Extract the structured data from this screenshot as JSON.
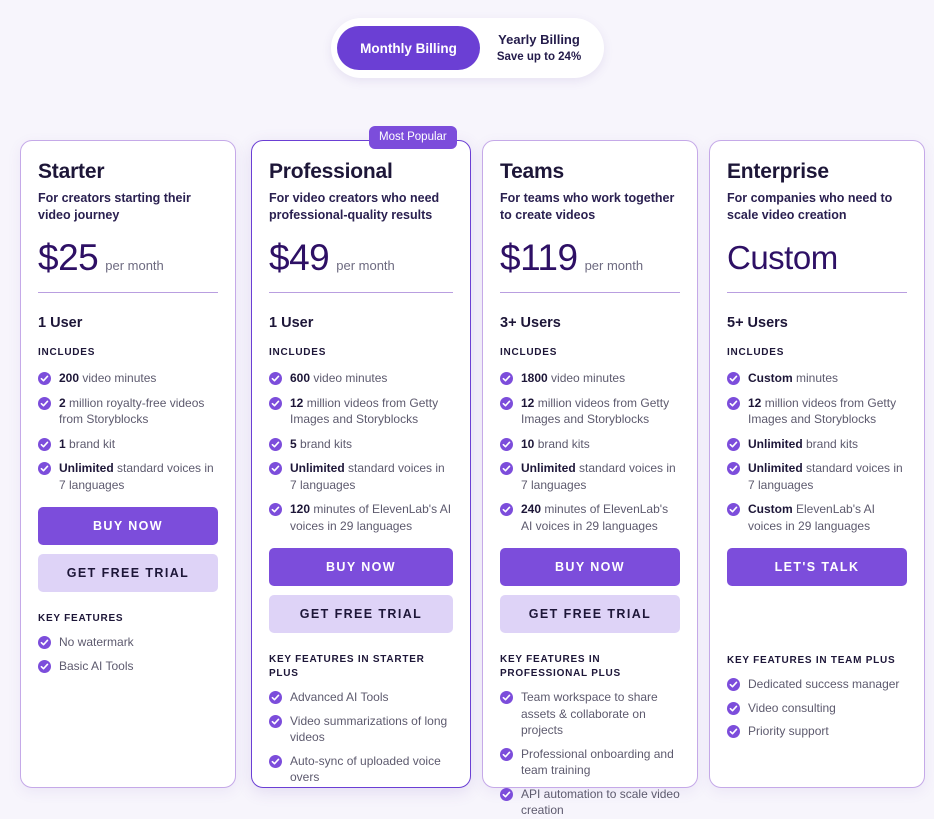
{
  "billing": {
    "monthly_label": "Monthly Billing",
    "yearly_label": "Yearly Billing",
    "yearly_sub": "Save up to 24%",
    "selected": "monthly",
    "accent_color": "#6b3fd4"
  },
  "badge": {
    "most_popular": "Most Popular"
  },
  "labels": {
    "includes": "INCLUDES",
    "buy_now": "BUY NOW",
    "get_free_trial": "GET FREE TRIAL",
    "lets_talk": "LET'S TALK"
  },
  "plans": [
    {
      "name": "Starter",
      "description": "For creators starting their video journey",
      "price": "$25",
      "period": "per month",
      "seats": "1 User",
      "includes_label": "INCLUDES",
      "includes": [
        {
          "strong": "200",
          "rest": " video minutes"
        },
        {
          "strong": "2",
          "rest": " million royalty-free videos from Storyblocks"
        },
        {
          "strong": "1",
          "rest": " brand kit"
        },
        {
          "strong": "Unlimited",
          "rest": " standard voices in 7 languages"
        }
      ],
      "primary_cta": "BUY NOW",
      "secondary_cta": "GET FREE TRIAL",
      "key_features_label": "KEY FEATURES",
      "key_features": [
        "No watermark",
        "Basic AI Tools"
      ]
    },
    {
      "name": "Professional",
      "description": "For video creators who need professional-quality results",
      "price": "$49",
      "period": "per month",
      "seats": "1 User",
      "includes_label": "INCLUDES",
      "includes": [
        {
          "strong": "600",
          "rest": " video minutes"
        },
        {
          "strong": "12",
          "rest": " million videos from Getty Images and Storyblocks"
        },
        {
          "strong": "5",
          "rest": " brand kits"
        },
        {
          "strong": "Unlimited",
          "rest": " standard voices in 7 languages"
        },
        {
          "strong": "120",
          "rest": " minutes of ElevenLab's AI voices in 29 languages"
        }
      ],
      "primary_cta": "BUY NOW",
      "secondary_cta": "GET FREE TRIAL",
      "key_features_label": "KEY FEATURES IN STARTER PLUS",
      "key_features": [
        "Advanced AI Tools",
        "Video summarizations of long videos",
        "Auto-sync of uploaded voice overs"
      ]
    },
    {
      "name": "Teams",
      "description": "For teams who work together to create videos",
      "price": "$119",
      "period": "per month",
      "seats": "3+ Users",
      "includes_label": "INCLUDES",
      "includes": [
        {
          "strong": "1800",
          "rest": " video minutes"
        },
        {
          "strong": "12",
          "rest": " million videos from Getty Images and Storyblocks"
        },
        {
          "strong": "10",
          "rest": " brand kits"
        },
        {
          "strong": "Unlimited",
          "rest": " standard voices in 7 languages"
        },
        {
          "strong": "240",
          "rest": " minutes of ElevenLab's AI voices in 29 languages"
        }
      ],
      "primary_cta": "BUY NOW",
      "secondary_cta": "GET FREE TRIAL",
      "key_features_label": "KEY FEATURES IN PROFESSIONAL PLUS",
      "key_features": [
        "Team workspace to share assets & collaborate on projects",
        "Professional onboarding and team training",
        "API automation to scale video creation"
      ]
    },
    {
      "name": "Enterprise",
      "description": "For companies who need  to scale video creation",
      "price": "Custom",
      "period": "",
      "seats": "5+ Users",
      "includes_label": "INCLUDES",
      "includes": [
        {
          "strong": "Custom",
          "rest": " minutes"
        },
        {
          "strong": "12",
          "rest": " million videos from Getty Images and Storyblocks"
        },
        {
          "strong": "Unlimited",
          "rest": " brand kits"
        },
        {
          "strong": "Unlimited",
          "rest": " standard voices in 7 languages"
        },
        {
          "strong": "Custom",
          "rest": " ElevenLab's AI voices in 29 languages"
        }
      ],
      "primary_cta": "LET'S TALK",
      "secondary_cta": null,
      "key_features_label": "KEY FEATURES IN TEAM PLUS",
      "key_features": [
        "Dedicated success manager",
        "Video consulting",
        "Priority support"
      ]
    }
  ],
  "theme": {
    "background": "#f7f5fc",
    "primary": "#7c4ddb",
    "primary_dark": "#6b3fd4",
    "secondary_button": "#ded3f7",
    "card_border": "#c5a9e8",
    "text_dark": "#1d1638",
    "text_muted": "#5d5a6e"
  }
}
